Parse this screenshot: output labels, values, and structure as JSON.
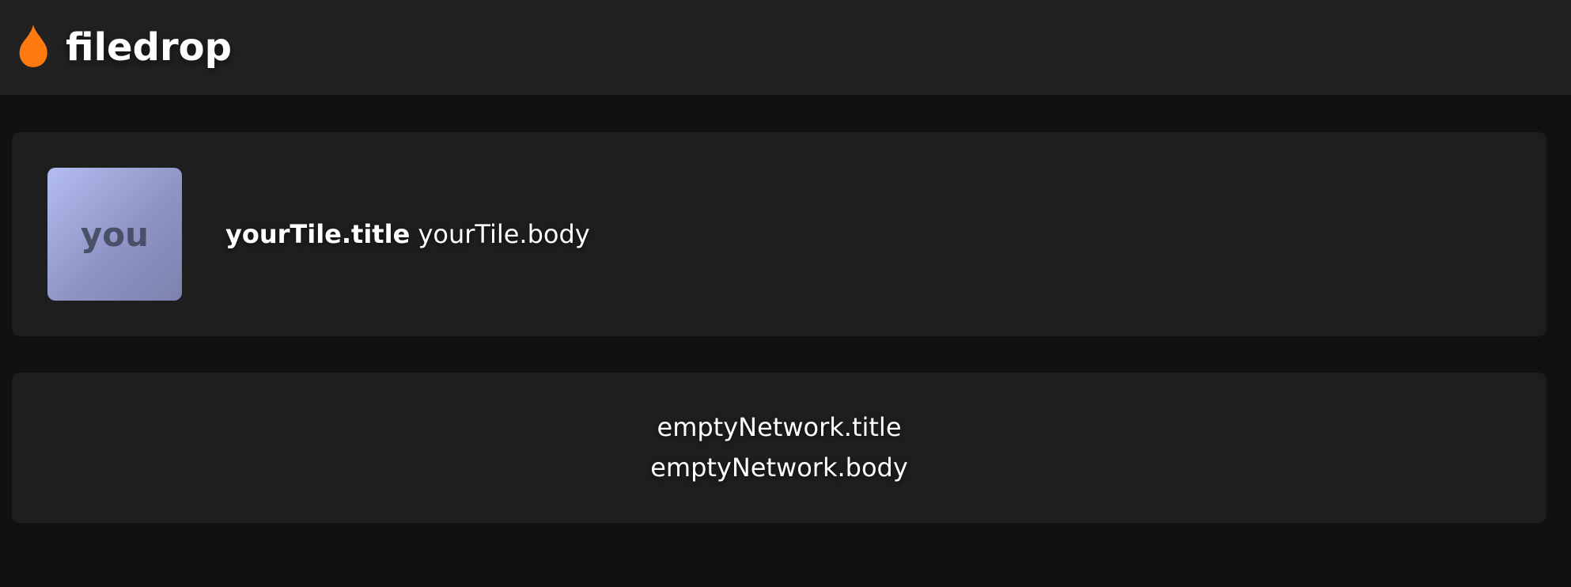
{
  "header": {
    "brand_name": "filedrop",
    "brand_icon": "flame-drop-icon",
    "brand_color": "#ff7a0f"
  },
  "your_tile": {
    "avatar_label": "you",
    "title": "yourTile.title",
    "body": "yourTile.body"
  },
  "empty_network": {
    "title": "emptyNetwork.title",
    "body": "emptyNetwork.body"
  },
  "colors": {
    "page_background": "#111111",
    "header_background": "#212121",
    "card_background": "#1e1e1e",
    "avatar_gradient_start": "#b4bdf0",
    "avatar_gradient_end": "#7d82ad"
  }
}
